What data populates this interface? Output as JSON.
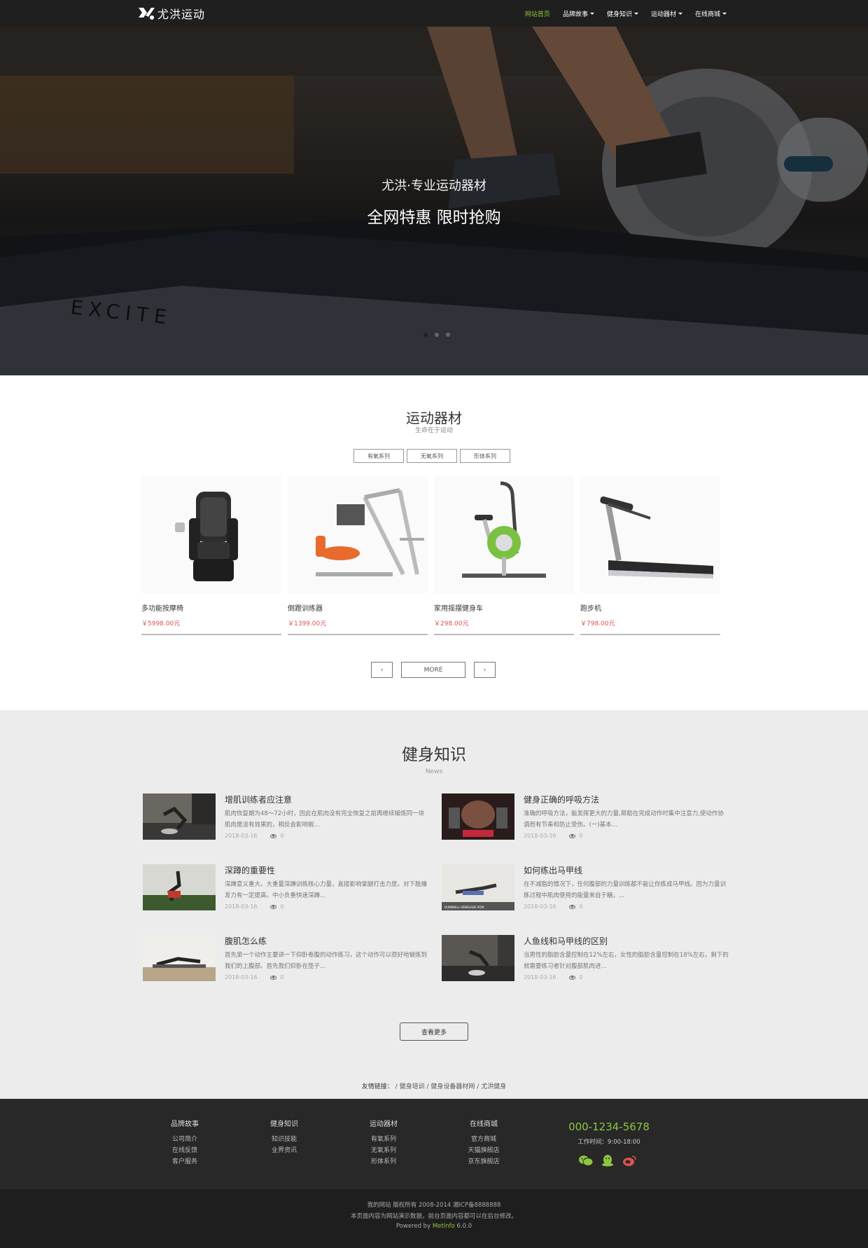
{
  "brand": {
    "name": "尤洪运动"
  },
  "nav": {
    "items": [
      {
        "label": "网站首页",
        "active": true
      },
      {
        "label": "品牌故事",
        "dropdown": true
      },
      {
        "label": "健身知识",
        "dropdown": true
      },
      {
        "label": "运动器材",
        "dropdown": true
      },
      {
        "label": "在线商城",
        "dropdown": true
      }
    ],
    "active_color": "#8dc63f"
  },
  "hero": {
    "subtitle": "尤洪·专业运动器材",
    "title": "全网特惠 限时抢购",
    "machine_text": "EXCITE",
    "slides": 3,
    "active_slide": 1
  },
  "products": {
    "title": "运动器材",
    "subtitle": "生命在于运动",
    "filters": [
      "有氧系列",
      "无氧系列",
      "形体系列"
    ],
    "items": [
      {
        "name": "多功能按摩椅",
        "price": "￥5998.00元",
        "icon": "massage-chair"
      },
      {
        "name": "倒蹬训练器",
        "price": "￥1399.00元",
        "icon": "leg-press"
      },
      {
        "name": "家用摇摆健身车",
        "price": "￥298.00元",
        "icon": "exercise-bike"
      },
      {
        "name": "跑步机",
        "price": "￥798.00元",
        "icon": "treadmill"
      }
    ],
    "prev_label": "‹",
    "more_label": "MORE",
    "next_label": "›"
  },
  "news": {
    "title": "健身知识",
    "subtitle": "News",
    "items": [
      {
        "title": "增肌训练者应注意",
        "desc": "肌肉恢复期为48～72小时，因此在肌肉没有完全恢复之前再继续锻炼同一块肌肉是没有效果的，相反会影响锻...",
        "date": "2018-03-16",
        "views": "0"
      },
      {
        "title": "健身正确的呼吸方法",
        "desc": "准确的呼吸方法，能发挥更大的力量,帮助在完成动作时集中注意力,使动作协调而有节奏和防止受伤。(一)基本...",
        "date": "2018-03-16",
        "views": "0"
      },
      {
        "title": "深蹲的重要性",
        "desc": "深蹲意义重大。大重量深蹲训练核心力量，直接影响掌腿打击力度。对下肢爆发力有一定提高。中小负重快速深蹲...",
        "date": "2018-03-16",
        "views": "0"
      },
      {
        "title": "如何练出马甲线",
        "desc": "在不减脂的情况下，任何腹部的力量训练都不能让你练成马甲线。因为力量训练过程中肌肉使用的能量来自于糖，...",
        "date": "2018-03-16",
        "views": "0"
      },
      {
        "title": "腹肌怎么练",
        "desc": "首先第一个动作主要讲一下仰卧卷腹的动作练习，这个动作可以很好地锻炼到我们的上腹部。首先我们仰卧在垫子...",
        "date": "2018-03-16",
        "views": "0"
      },
      {
        "title": "人鱼线和马甲线的区别",
        "desc": "当男性的脂肪含量控制在12%左右，女性的脂肪含量控制在18%左右，剩下的就需要练习者针对腹部肌肉进...",
        "date": "2018-03-16",
        "views": "0"
      }
    ],
    "more_label": "查看更多",
    "thumb_caption": "DUMBBELL RENEGADE ROW"
  },
  "links": {
    "label": "友情链接：",
    "sep": "/",
    "items": [
      "健身培训",
      "健身设备器材网",
      "尤洪健身"
    ]
  },
  "footer": {
    "columns": [
      {
        "title": "品牌故事",
        "links": [
          "公司简介",
          "在线反馈",
          "客户服务"
        ]
      },
      {
        "title": "健身知识",
        "links": [
          "知识技能",
          "业界资讯"
        ]
      },
      {
        "title": "运动器材",
        "links": [
          "有氧系列",
          "无氧系列",
          "形体系列"
        ]
      },
      {
        "title": "在线商城",
        "links": [
          "官方商城",
          "天猫旗舰店",
          "京东旗舰店"
        ]
      }
    ],
    "phone": "000-1234-5678",
    "hours": "工作时间：9:00-18:00",
    "socials": [
      "wechat-icon",
      "qq-icon",
      "weibo-icon"
    ],
    "copyright": "我的网站 版权所有 2008-2014 湘ICP备8888888",
    "notice": "本页面内容为网站演示数据，前台页面内容都可以在后台修改。",
    "powered_prefix": "Powered by",
    "powered_brand": "MetInfo",
    "powered_version": "6.0.0"
  }
}
